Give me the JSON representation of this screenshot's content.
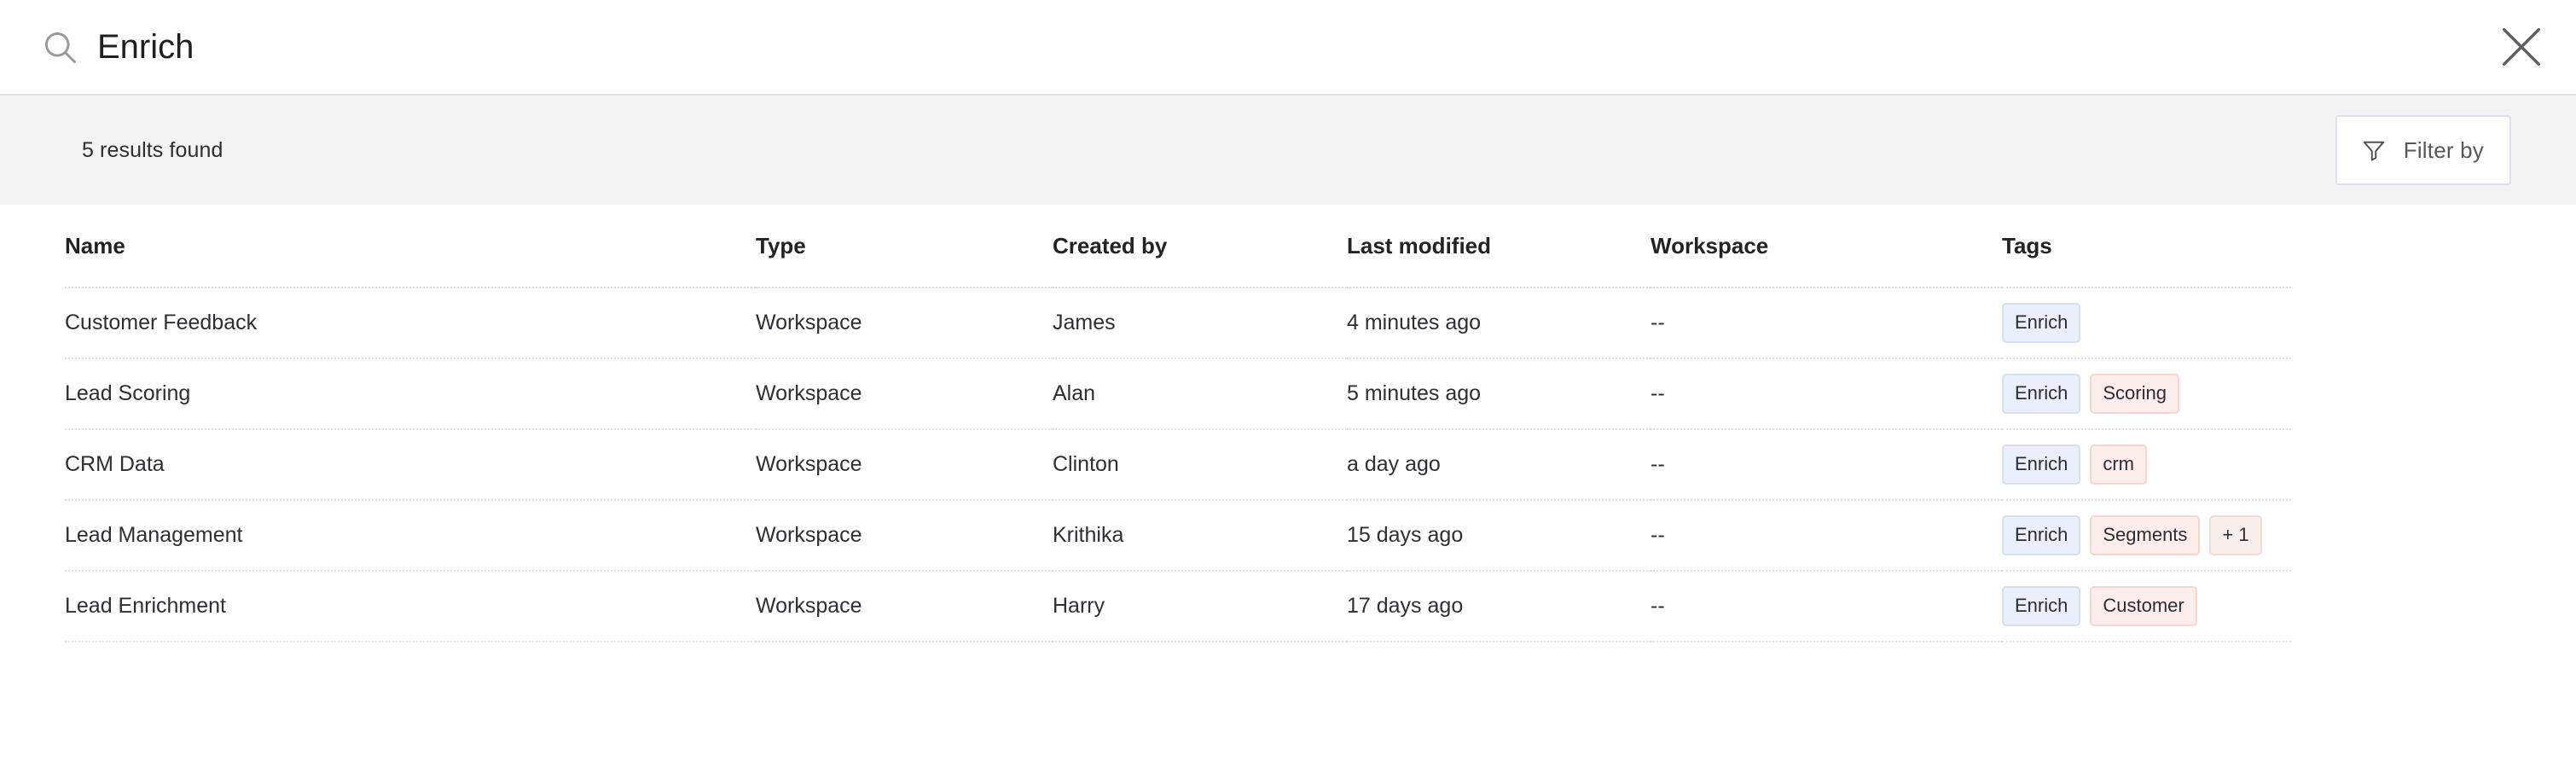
{
  "search": {
    "icon": "search-icon",
    "value": "Enrich",
    "placeholder": "Search",
    "close_icon": "close-icon"
  },
  "results_bar": {
    "count_label": "5 results found",
    "filter": {
      "icon": "filter-funnel-icon",
      "label": "Filter by"
    }
  },
  "table": {
    "columns": [
      {
        "key": "name",
        "label": "Name"
      },
      {
        "key": "type",
        "label": "Type"
      },
      {
        "key": "createdby",
        "label": "Created by"
      },
      {
        "key": "modified",
        "label": "Last modified"
      },
      {
        "key": "workspace",
        "label": "Workspace"
      },
      {
        "key": "tags",
        "label": "Tags"
      }
    ],
    "rows": [
      {
        "name": "Customer Feedback",
        "type": "Workspace",
        "createdby": "James",
        "modified": "4 minutes ago",
        "workspace": "--",
        "tags": [
          {
            "label": "Enrich",
            "color": "blue"
          }
        ]
      },
      {
        "name": "Lead Scoring",
        "type": "Workspace",
        "createdby": "Alan",
        "modified": "5 minutes ago",
        "workspace": "--",
        "tags": [
          {
            "label": "Enrich",
            "color": "blue"
          },
          {
            "label": "Scoring",
            "color": "pink"
          }
        ]
      },
      {
        "name": "CRM Data",
        "type": "Workspace",
        "createdby": "Clinton",
        "modified": "a day ago",
        "workspace": "--",
        "tags": [
          {
            "label": "Enrich",
            "color": "blue"
          },
          {
            "label": "crm",
            "color": "pink"
          }
        ]
      },
      {
        "name": "Lead Management",
        "type": "Workspace",
        "createdby": "Krithika",
        "modified": "15 days ago",
        "workspace": "--",
        "tags": [
          {
            "label": "Enrich",
            "color": "blue"
          },
          {
            "label": "Segments",
            "color": "pink"
          },
          {
            "label": "+ 1",
            "color": "more"
          }
        ]
      },
      {
        "name": "Lead Enrichment",
        "type": "Workspace",
        "createdby": "Harry",
        "modified": "17 days ago",
        "workspace": "--",
        "tags": [
          {
            "label": "Enrich",
            "color": "blue"
          },
          {
            "label": "Customer",
            "color": "pink"
          }
        ]
      }
    ]
  },
  "colors": {
    "results_bar_bg": "#f3f3f3",
    "tag_blue_bg": "#eaeffb",
    "tag_blue_border": "#d7deef",
    "tag_pink_bg": "#fdeeeb",
    "tag_pink_border": "#f7d6cf",
    "tag_more_bg": "#f8eeec",
    "filter_border": "#e0e0ec",
    "text_primary": "#232326"
  }
}
